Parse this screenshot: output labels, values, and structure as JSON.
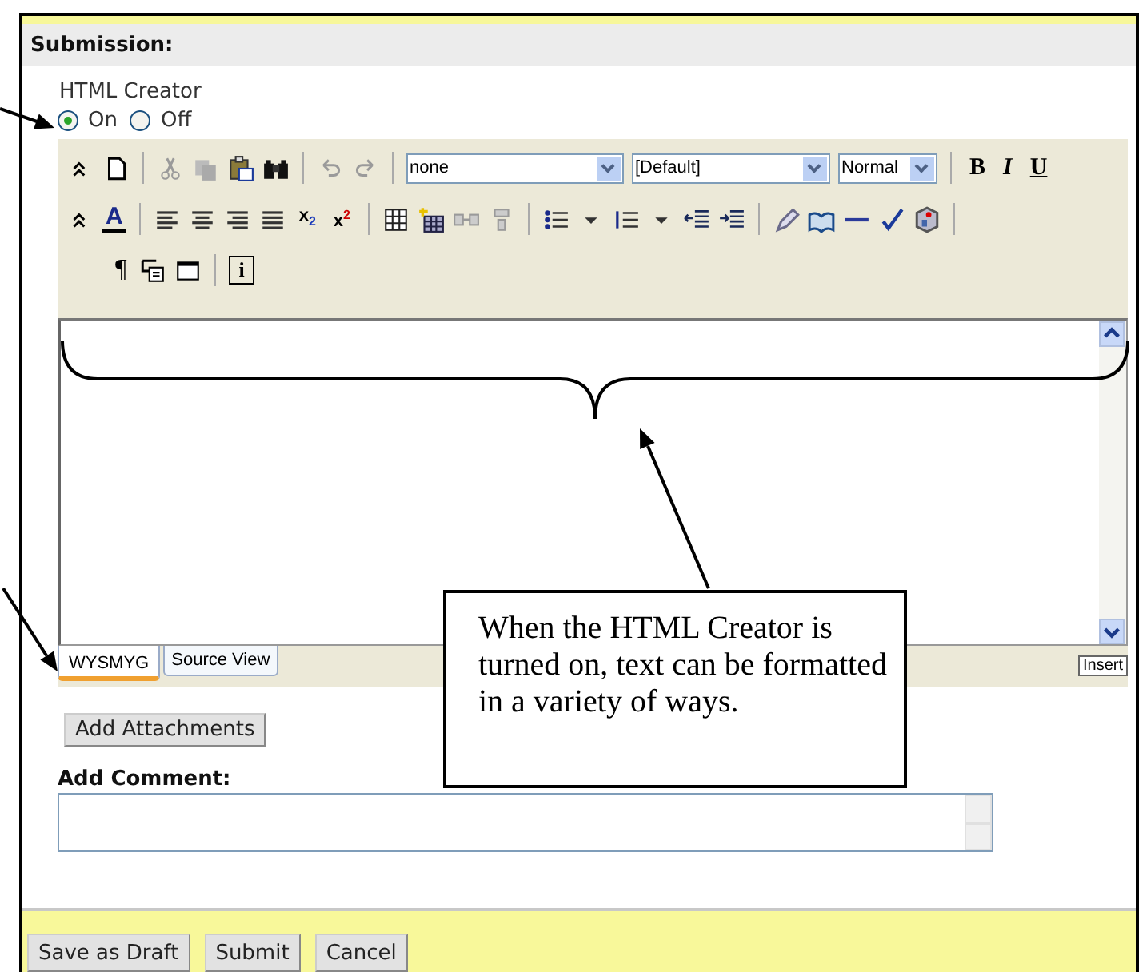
{
  "section": {
    "title": "Submission:"
  },
  "html_creator": {
    "label": "HTML Creator",
    "options": [
      {
        "label": "On",
        "selected": true
      },
      {
        "label": "Off",
        "selected": false
      }
    ]
  },
  "toolbar": {
    "style_select": "none",
    "font_select": "[Default]",
    "size_select": "Normal",
    "bold": "B",
    "italic": "I",
    "underline": "U",
    "font_color": "A",
    "subscript": "x$_{2}$",
    "superscript": "x$^{2}$",
    "paragraph": "¶",
    "info": "i"
  },
  "editor": {
    "tabs": [
      {
        "label": "WYSMYG",
        "selected": true
      },
      {
        "label": "Source View",
        "selected": false
      }
    ],
    "mode": "Insert"
  },
  "attach_button": "Add Attachments",
  "comment": {
    "label": "Add Comment:"
  },
  "footer_buttons": [
    "Save as Draft",
    "Submit",
    "Cancel"
  ],
  "callout": "When the HTML Creator is turned on, text can be formatted in a variety of ways."
}
